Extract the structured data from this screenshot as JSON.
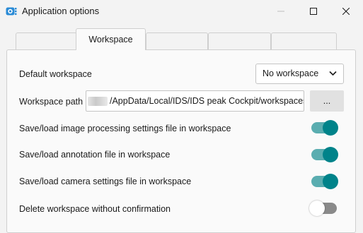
{
  "window": {
    "title": "Application options",
    "icon": "camera-app-icon",
    "controls": [
      "minimize-icon",
      "maximize-icon",
      "close-icon"
    ]
  },
  "tabs": [
    {
      "label": ""
    },
    {
      "label": "Workspace",
      "active": true
    },
    {
      "label": ""
    },
    {
      "label": ""
    },
    {
      "label": ""
    }
  ],
  "settings": {
    "default_workspace": {
      "label": "Default workspace",
      "value": "No workspace"
    },
    "workspace_path": {
      "label": "Workspace path",
      "value": "/AppData/Local/IDS/IDS peak Cockpit/workspaces",
      "browse_label": "..."
    },
    "toggles": [
      {
        "label": "Save/load image processing settings file in workspace",
        "on": true
      },
      {
        "label": "Save/load annotation file in workspace",
        "on": true
      },
      {
        "label": "Save/load camera settings file in workspace",
        "on": true
      },
      {
        "label": "Delete workspace without confirmation",
        "on": false
      }
    ]
  },
  "colors": {
    "accent": "#00838a",
    "track_on": "#5aadb0",
    "track_off": "#8a8a8a"
  }
}
